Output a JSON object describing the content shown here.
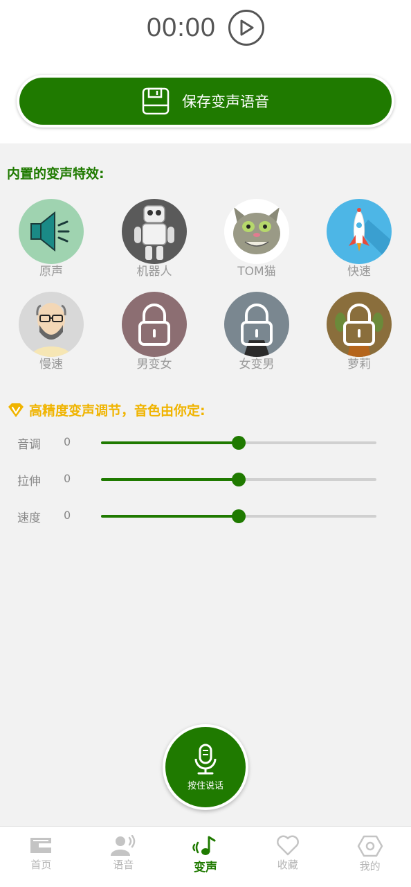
{
  "player": {
    "time": "00:00"
  },
  "save_button": {
    "label": "保存变声语音"
  },
  "effects_section": {
    "title": "内置的变声特效:",
    "items": [
      {
        "label": "原声",
        "icon": "speaker-icon",
        "locked": false
      },
      {
        "label": "机器人",
        "icon": "robot-icon",
        "locked": false
      },
      {
        "label": "TOM猫",
        "icon": "tom-cat-icon",
        "locked": false
      },
      {
        "label": "快速",
        "icon": "rocket-icon",
        "locked": false
      },
      {
        "label": "慢速",
        "icon": "old-man-icon",
        "locked": false
      },
      {
        "label": "男变女",
        "icon": "lock-icon",
        "locked": true
      },
      {
        "label": "女变男",
        "icon": "lock-icon",
        "locked": true
      },
      {
        "label": "萝莉",
        "icon": "lock-icon",
        "locked": true
      }
    ]
  },
  "adjust_section": {
    "title": "高精度变声调节，音色由你定:",
    "sliders": [
      {
        "name": "音调",
        "value": "0",
        "position": 0.5
      },
      {
        "name": "拉伸",
        "value": "0",
        "position": 0.5
      },
      {
        "name": "速度",
        "value": "0",
        "position": 0.5
      }
    ]
  },
  "talk_button": {
    "label": "按住说话"
  },
  "tabbar": {
    "items": [
      {
        "label": "首页",
        "icon": "home-icon",
        "active": false
      },
      {
        "label": "语音",
        "icon": "voice-icon",
        "active": false
      },
      {
        "label": "变声",
        "icon": "music-note-icon",
        "active": true
      },
      {
        "label": "收藏",
        "icon": "heart-icon",
        "active": false
      },
      {
        "label": "我的",
        "icon": "hexagon-icon",
        "active": false
      }
    ]
  },
  "colors": {
    "accent": "#1f7a00",
    "gold": "#f0b400"
  }
}
